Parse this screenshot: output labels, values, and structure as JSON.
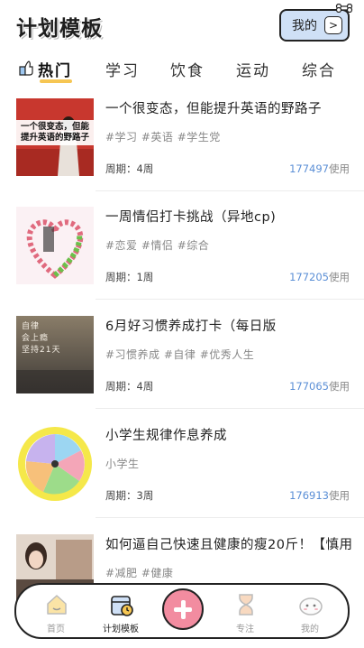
{
  "header": {
    "title": "计划模板",
    "mine_label": "我的",
    "mine_icon": "chevron-right-icon"
  },
  "tabs": [
    {
      "label": "热门",
      "active": true
    },
    {
      "label": "学习",
      "active": false
    },
    {
      "label": "饮食",
      "active": false
    },
    {
      "label": "运动",
      "active": false
    },
    {
      "label": "综合",
      "active": false
    }
  ],
  "items": [
    {
      "title": "一个很变态，但能提升英语的野路子",
      "tags": "#学习 #英语 #学生党",
      "period": "周期：4周",
      "count": "177497",
      "count_suffix": "使用",
      "thumb_text": "一个很变态，但能提升英语的野路子"
    },
    {
      "title": "一周情侣打卡挑战（异地cp)",
      "tags": "#恋爱 #情侣 #综合",
      "period": "周期：1周",
      "count": "177205",
      "count_suffix": "使用"
    },
    {
      "title": "6月好习惯养成打卡（每日版",
      "tags": "#习惯养成 #自律 #优秀人生",
      "period": "周期：4周",
      "count": "177065",
      "count_suffix": "使用",
      "thumb_text": "自律\n会上瘾\n坚持21天"
    },
    {
      "title": "小学生规律作息养成",
      "tags": "小学生",
      "period": "周期：3周",
      "count": "176913",
      "count_suffix": "使用"
    },
    {
      "title": "如何逼自己快速且健康的瘦20斤！【慎用",
      "tags": "#减肥 #健康",
      "period": "",
      "count": "",
      "count_suffix": ""
    }
  ],
  "nav": [
    {
      "label": "首页",
      "icon": "home-icon",
      "active": false
    },
    {
      "label": "计划模板",
      "icon": "calendar-icon",
      "active": true
    },
    {
      "label": "",
      "icon": "add-icon",
      "active": false
    },
    {
      "label": "专注",
      "icon": "hourglass-icon",
      "active": false
    },
    {
      "label": "我的",
      "icon": "profile-icon",
      "active": false
    }
  ],
  "colors": {
    "accent": "#f6c653",
    "count_blue": "#5b8fd6",
    "add_pink": "#f28ca0",
    "mine_bg": "#cfe0f6"
  }
}
